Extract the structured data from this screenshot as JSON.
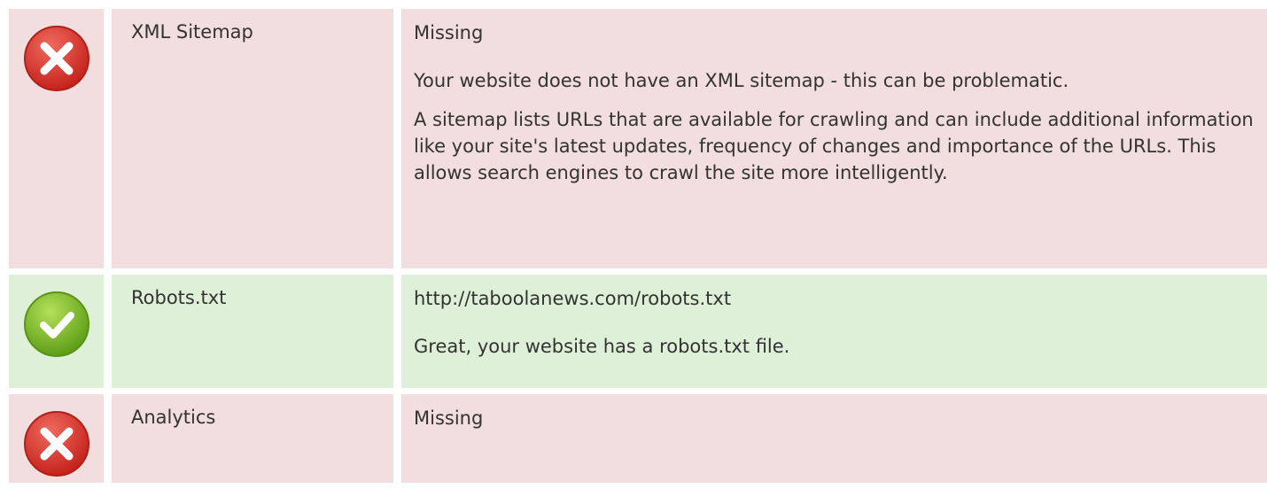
{
  "rows": [
    {
      "status": "fail",
      "icon": "error-x-icon",
      "label": "XML Sitemap",
      "value": "Missing",
      "paragraphs": [
        "Your website does not have an XML sitemap - this can be problematic.",
        "A sitemap lists URLs that are available for crawling and can include additional information like your site's latest updates, frequency of changes and importance of the URLs. This allows search engines to crawl the site more intelligently."
      ]
    },
    {
      "status": "pass",
      "icon": "success-check-icon",
      "label": "Robots.txt",
      "value": "http://taboolanews.com/robots.txt",
      "paragraphs": [
        "Great, your website has a robots.txt file."
      ]
    },
    {
      "status": "fail",
      "icon": "error-x-icon",
      "label": "Analytics",
      "value": "Missing",
      "paragraphs": []
    }
  ],
  "colors": {
    "fail_bg": "#f2dede",
    "pass_bg": "#dff0d8",
    "fail_icon": "#d9302a",
    "pass_icon": "#7ab928"
  }
}
